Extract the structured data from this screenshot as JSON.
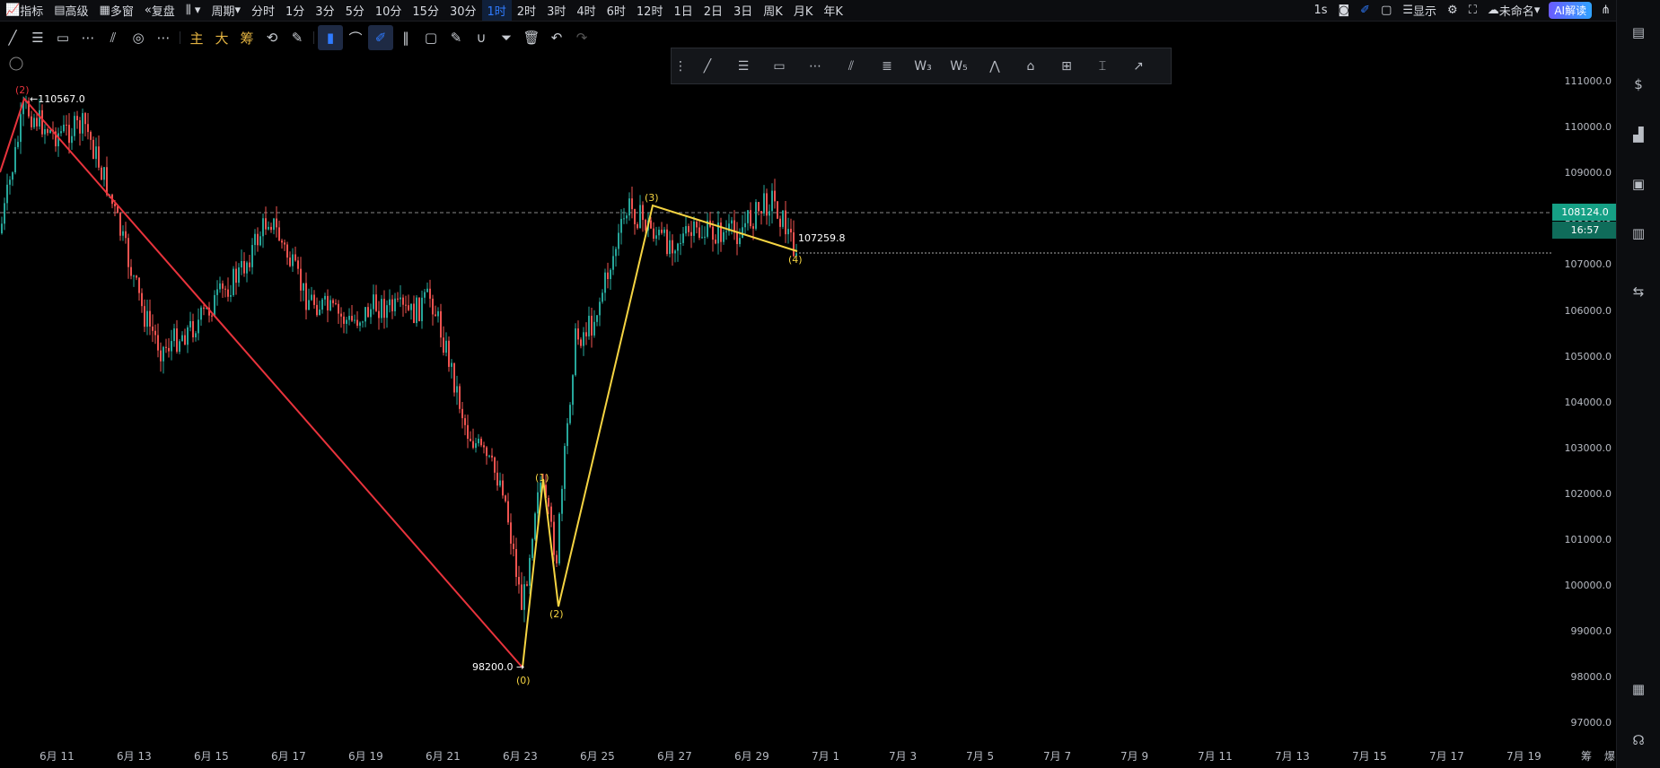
{
  "topbar": {
    "items": [
      "指标",
      "高级",
      "多窗",
      "复盘",
      "",
      "周期",
      "分时",
      "1分",
      "3分",
      "5分",
      "10分",
      "15分",
      "30分",
      "1时",
      "2时",
      "3时",
      "4时",
      "6时",
      "12时",
      "1日",
      "2日",
      "3日",
      "周K",
      "月K",
      "年K"
    ],
    "active_index": 13,
    "right": {
      "interval": "1s",
      "display": "显示",
      "unnamed": "未命名",
      "ai": "AI解读"
    }
  },
  "draw_toolbar": {
    "main": "主",
    "large": "大",
    "chips": "筹"
  },
  "price_axis": [
    "111000.0",
    "110000.0",
    "109000.0",
    "108000.0",
    "107000.0",
    "106000.0",
    "105000.0",
    "104000.0",
    "103000.0",
    "102000.0",
    "101000.0",
    "100000.0",
    "99000.0",
    "98000.0",
    "97000.0"
  ],
  "current_price": "108124.0",
  "countdown": "16:57",
  "time_axis": [
    "6月 11",
    "6月 13",
    "6月 15",
    "6月 17",
    "6月 19",
    "6月 21",
    "6月 23",
    "6月 25",
    "6月 27",
    "6月 29",
    "7月 1",
    "7月 3",
    "7月 5",
    "7月 7",
    "7月 9",
    "7月 11",
    "7月 13",
    "7月 15",
    "7月 17",
    "7月 19"
  ],
  "time_axis_right": [
    "筹",
    "爆"
  ],
  "annotations": {
    "high_label": "110567.0",
    "low_label": "98200.0",
    "end_label": "107259.8",
    "wave_labels": [
      "(2)",
      "(0)",
      "(1)",
      "(2)",
      "(3)",
      "(4)"
    ]
  },
  "colors": {
    "up": "#26a69a",
    "down": "#ef5350",
    "red_line": "#e8333c",
    "yellow_line": "#f5d442",
    "accent": "#2f7bff"
  }
}
